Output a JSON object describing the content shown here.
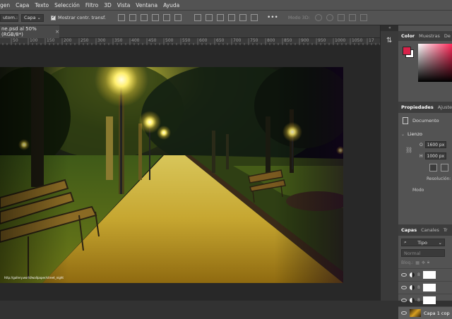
{
  "menu": [
    "gen",
    "Capa",
    "Texto",
    "Selección",
    "Filtro",
    "3D",
    "Vista",
    "Ventana",
    "Ayuda"
  ],
  "options": {
    "auto_select_label": "utom.:",
    "auto_select_value": "Capa",
    "show_transform_label": "Mostrar contr. transf.",
    "mode3d_label": "Modo 3D:"
  },
  "document_tab": {
    "title": "ne.psd al 50% (RGB/8*)",
    "close": "×"
  },
  "ruler": {
    "ticks": [
      "0",
      "50",
      "100",
      "150",
      "200",
      "250",
      "300",
      "350",
      "400",
      "450",
      "500",
      "550",
      "600",
      "650",
      "700",
      "750",
      "800",
      "850",
      "900",
      "950",
      "1000",
      "1050",
      "17"
    ]
  },
  "photo": {
    "watermark": "http://gallery.world/wallpaper/street_night"
  },
  "color_panel": {
    "tabs": [
      "Color",
      "Muestras",
      "De"
    ],
    "fg_color": "#d8234a",
    "bg_color": "#ffffff"
  },
  "properties_panel": {
    "tabs": [
      "Propiedades",
      "Ajustes"
    ],
    "doc_label": "Documento",
    "section": "Lienzo",
    "width_label": "O",
    "width_value": "1600 px",
    "height_label": "H",
    "height_value": "1000 px",
    "resolution_label": "Resolución:",
    "mode_label": "Modo"
  },
  "layers_panel": {
    "tabs": [
      "Capas",
      "Canales",
      "Tr"
    ],
    "filter_label": "Tipo",
    "blend_mode": "Normal",
    "lock_label": "Bloq.:",
    "layers": [
      {
        "name": ""
      },
      {
        "name": ""
      },
      {
        "name": ""
      },
      {
        "name": "Capa 1 cop"
      }
    ]
  }
}
